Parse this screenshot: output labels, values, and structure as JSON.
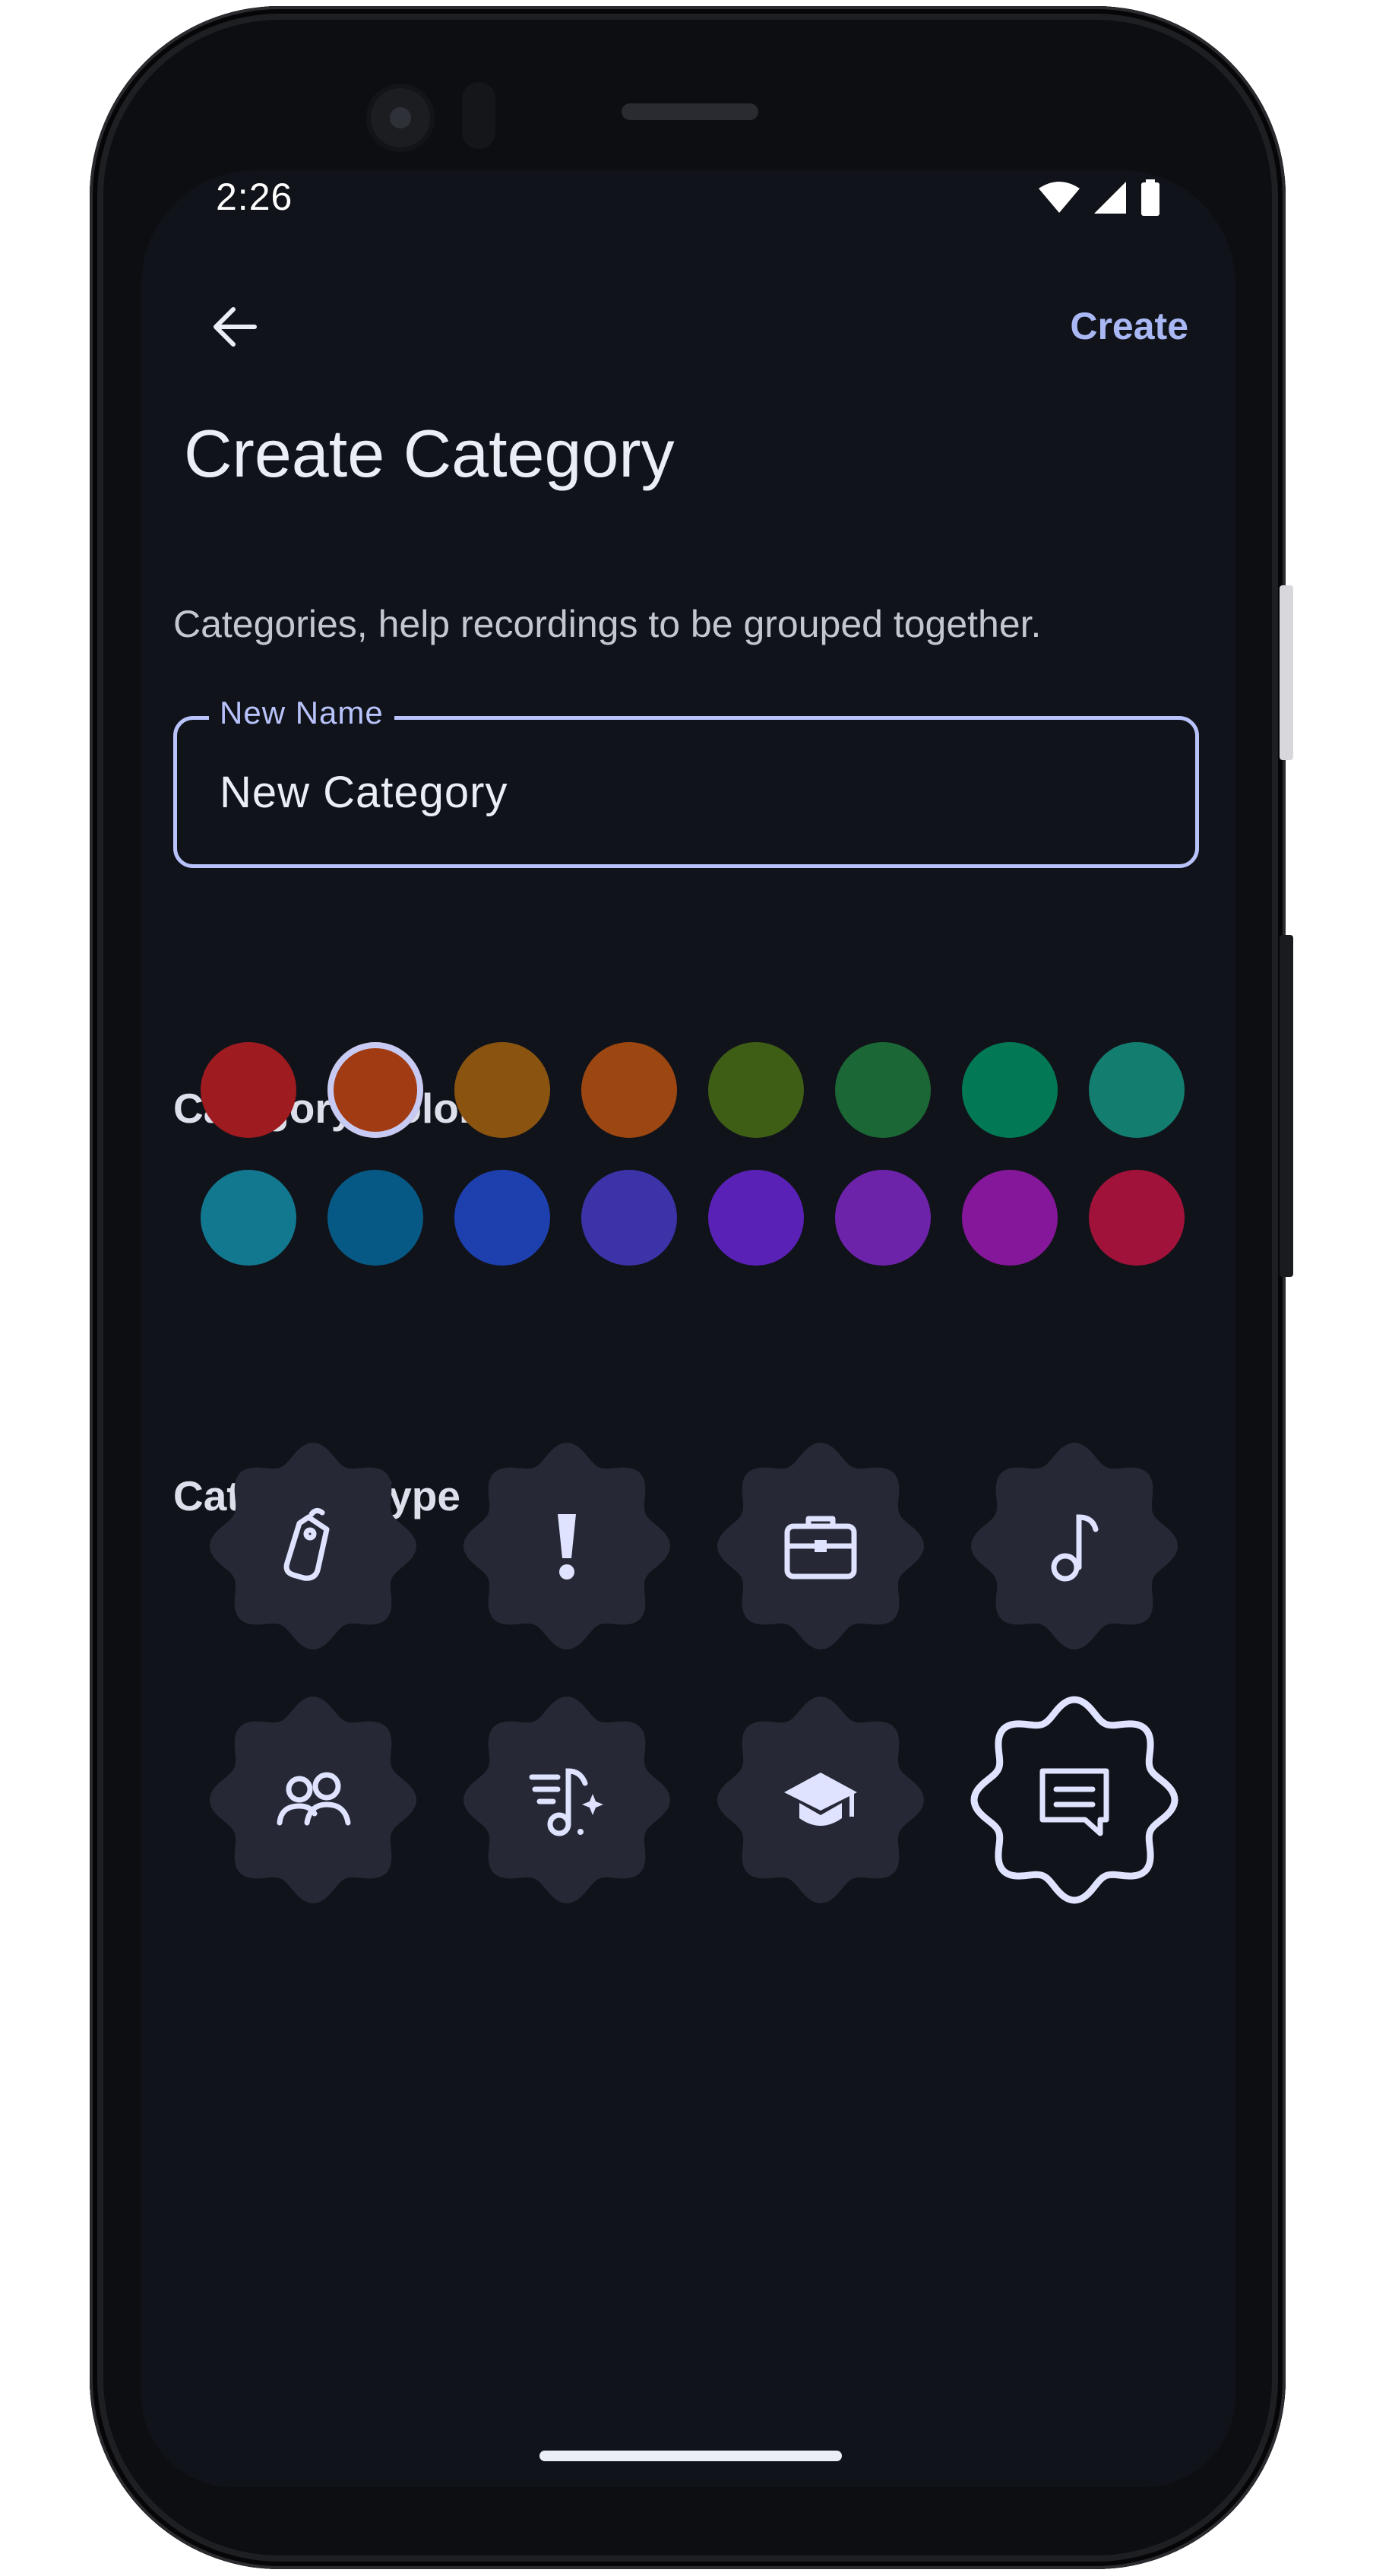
{
  "status_bar": {
    "time": "2:26"
  },
  "toolbar": {
    "back_icon": "arrow-back-icon",
    "create_label": "Create"
  },
  "page": {
    "title": "Create Category",
    "description": "Categories, help recordings to be grouped together."
  },
  "name_field": {
    "label": "New Name",
    "value": "New Category"
  },
  "color_section": {
    "label": "Category Color",
    "selected_index": 1,
    "colors": [
      "#9e1b1f",
      "#a03b14",
      "#8a5410",
      "#9c4712",
      "#3f5e15",
      "#1b6735",
      "#037854",
      "#137d6f",
      "#12788f",
      "#075985",
      "#1d40ae",
      "#3b33a7",
      "#5a21b6",
      "#6c23aa",
      "#85179a",
      "#a01239"
    ]
  },
  "type_section": {
    "label": "Category Type",
    "selected_index": 7,
    "types": [
      {
        "icon": "tag-icon"
      },
      {
        "icon": "priority-exclamation-icon"
      },
      {
        "icon": "briefcase-icon"
      },
      {
        "icon": "music-note-icon"
      },
      {
        "icon": "group-icon"
      },
      {
        "icon": "music-sparkle-icon"
      },
      {
        "icon": "graduation-cap-icon"
      },
      {
        "icon": "message-icon"
      }
    ]
  },
  "theme": {
    "accent": "#b8c3fb",
    "background": "#11131a",
    "badge_fill": "#262935"
  }
}
